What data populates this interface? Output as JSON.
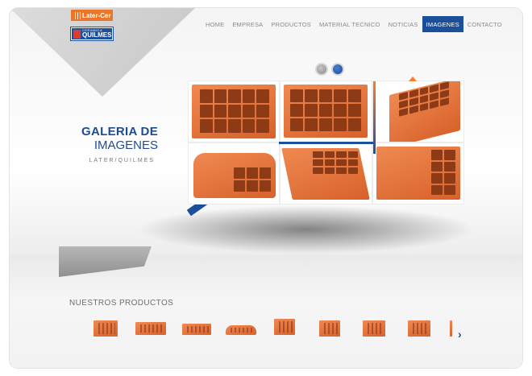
{
  "brand": {
    "logo_top": "Later-Cer",
    "logo_bottom_small": "CERAMICA",
    "logo_bottom_main": "QUILMES"
  },
  "nav": {
    "items": [
      {
        "label": "HOME",
        "active": false
      },
      {
        "label": "EMPRESA",
        "active": false
      },
      {
        "label": "PRODUCTOS",
        "active": false
      },
      {
        "label": "MATERIAL TECNICO",
        "active": false
      },
      {
        "label": "NOTICIAS",
        "active": false
      },
      {
        "label": "IMAGENES",
        "active": true
      },
      {
        "label": "CONTACTO",
        "active": false
      }
    ]
  },
  "hero": {
    "title_line1": "GALERIA DE",
    "title_line2": "IMAGENES",
    "subtitle": "LATER/QUILMES"
  },
  "slider": {
    "dots": 2,
    "active_dot": 2
  },
  "gallery": {
    "tiles": 6
  },
  "products": {
    "heading": "NUESTROS PRODUCTOS",
    "count": 9
  },
  "colors": {
    "brand_blue": "#1c4f9a",
    "brick_orange": "#e3713a",
    "nav_text": "#8a8a8a"
  },
  "icons": {
    "next": "chevron-right-icon"
  }
}
